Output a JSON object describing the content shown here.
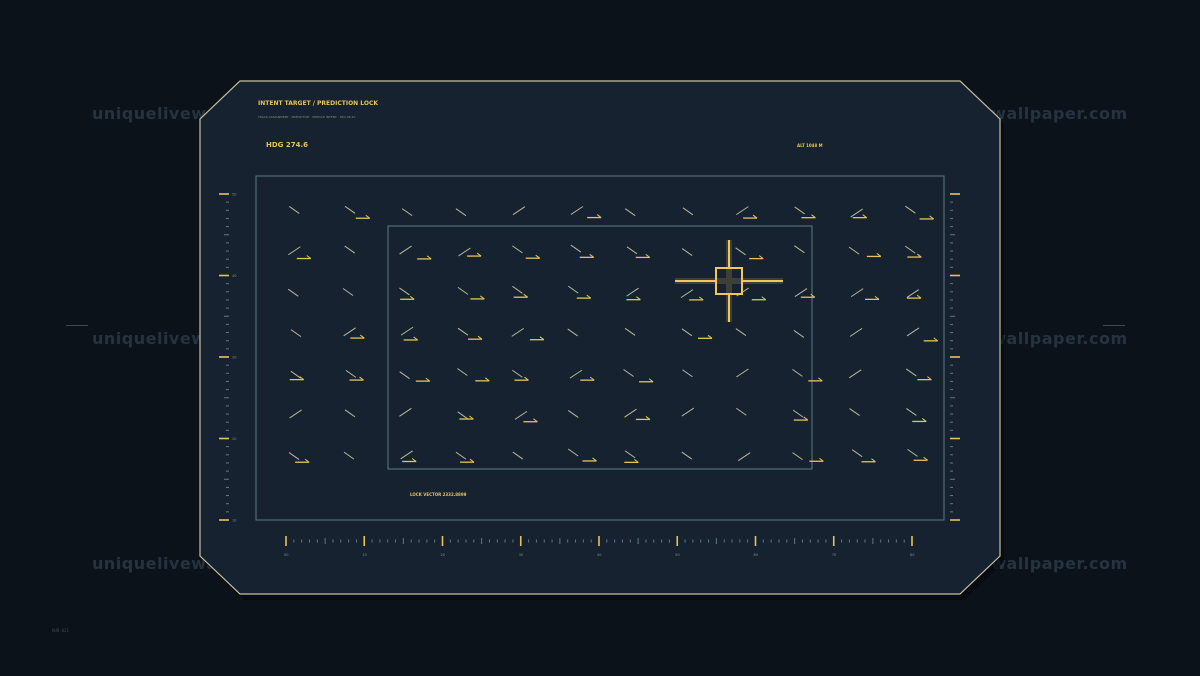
{
  "hud": {
    "title": "INTENT TARGET / PREDICTION LOCK",
    "subtitle": "TRACK ASSIGNMENT · PREDICTIVE · VEHICLE INTENT · SEQ 08.20",
    "heading": "HDG 274.6",
    "altitude": "ALT 1048 M",
    "lock_vector": "LOCK VECTOR 2332.8899",
    "corner_tag": "HUD-021"
  },
  "watermark": "uniquelivewallpaper.com",
  "colors": {
    "accent": "#e6c35a",
    "frame": "#c8c2a0",
    "grid_line": "#5f7a86",
    "panel": "#162230",
    "background": "#0b121a",
    "muted_vector": "#b9b79a"
  },
  "reticle": {
    "status": "locked",
    "icon": "crosshair-icon"
  },
  "scales": {
    "left_labels": [
      "50",
      "40",
      "30",
      "20",
      "10"
    ],
    "bottom_labels": [
      "00",
      "10",
      "20",
      "30",
      "40",
      "50",
      "60",
      "70",
      "80"
    ]
  }
}
